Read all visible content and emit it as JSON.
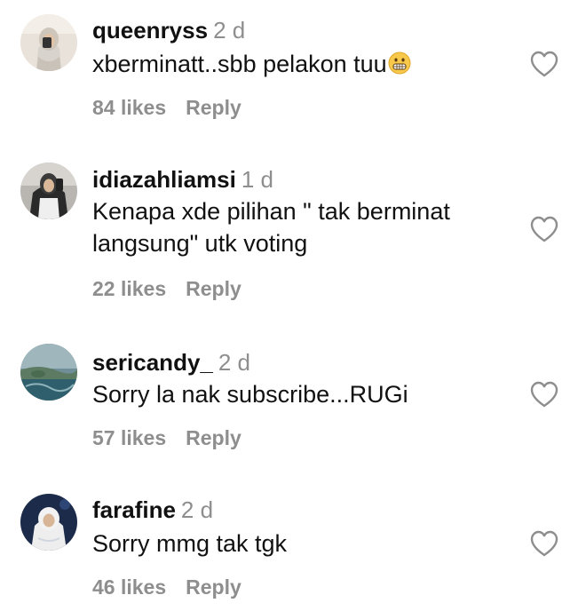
{
  "comments": [
    {
      "username": "queenryss",
      "time": "2 d",
      "text": "xberminatt..sbb pelakon tuu",
      "emoji": "grimacing-face-emoji",
      "likes": "84 likes",
      "reply": "Reply",
      "avatar": "profile-photo-woman-hijab",
      "heart": "heart-outline-icon"
    },
    {
      "username": "idiazahliamsi",
      "time": "1 d",
      "text": "Kenapa xde pilihan \" tak berminat langsung\" utk voting",
      "likes": "22 likes",
      "reply": "Reply",
      "avatar": "profile-photo-woman-dark",
      "heart": "heart-outline-icon"
    },
    {
      "username": "sericandy_",
      "time": "2 d",
      "text": "Sorry la nak subscribe...RUGi",
      "likes": "57 likes",
      "reply": "Reply",
      "avatar": "profile-photo-landscape",
      "heart": "heart-outline-icon"
    },
    {
      "username": "farafine",
      "time": "2 d",
      "text": "Sorry mmg tak tgk",
      "likes": "46 likes",
      "reply": "Reply",
      "avatar": "profile-photo-woman-night",
      "heart": "heart-outline-icon"
    }
  ],
  "colors": {
    "text": "#111111",
    "muted": "#8e8e8e",
    "background": "#ffffff"
  }
}
